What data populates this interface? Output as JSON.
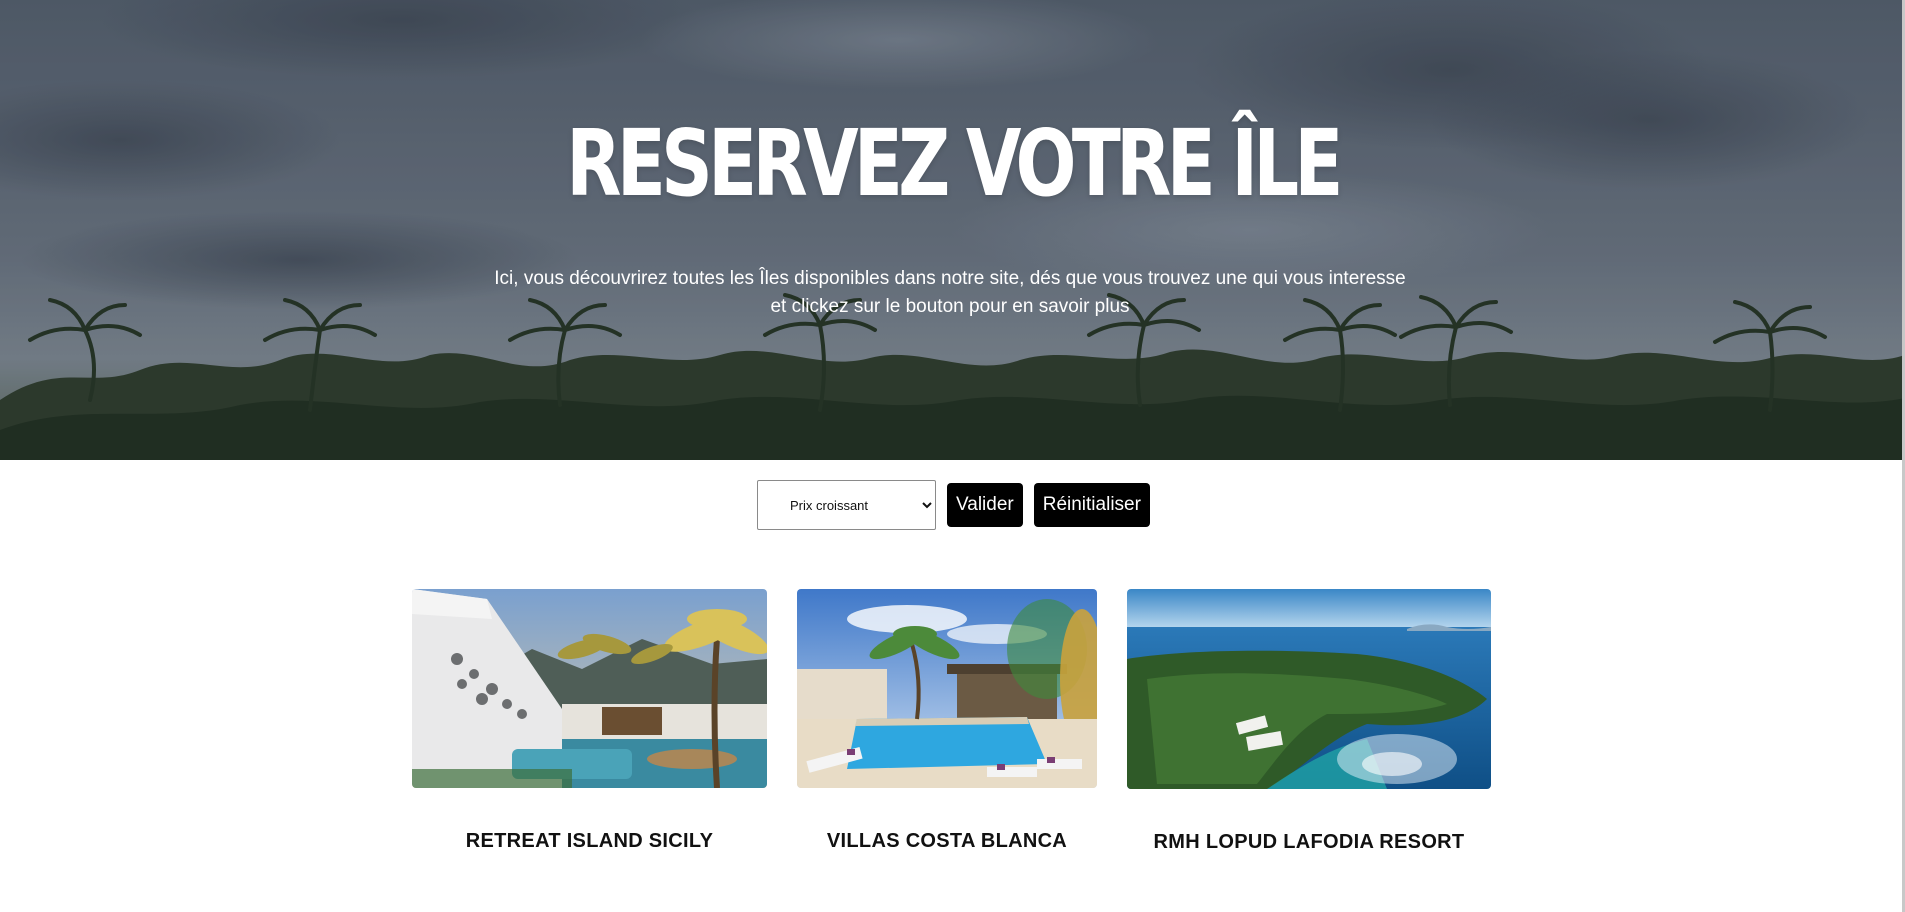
{
  "hero": {
    "title": "RESERVEZ VOTRE ÎLE",
    "subtitle": "Ici, vous découvrirez toutes les Îles disponibles dans notre site, dés que vous trouvez une qui vous interesse et clickez sur le bouton pour en savoir plus"
  },
  "filters": {
    "sort_selected": "Prix croissant",
    "validate_label": "Valider",
    "reset_label": "Réinitialiser"
  },
  "cards": [
    {
      "name": "RETREAT ISLAND SICILY"
    },
    {
      "name": "VILLAS COSTA BLANCA"
    },
    {
      "name": "RMH LOPUD LAFODIA RESORT"
    }
  ]
}
